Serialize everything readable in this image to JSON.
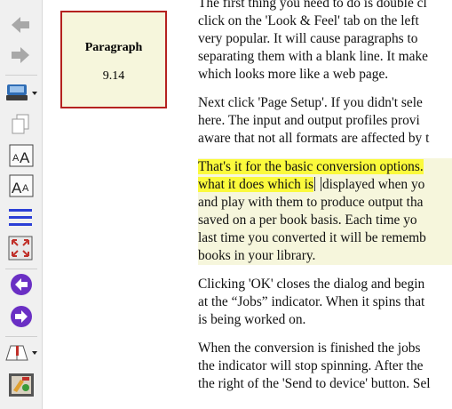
{
  "reference_panel": {
    "title": "Paragraph",
    "value": "9.14"
  },
  "paragraphs": [
    [
      "The first thing you need to do is double cl",
      "click on the 'Look & Feel' tab on the left",
      "very popular. It will cause paragraphs to",
      "separating them with a blank line. It make",
      "which looks more like a web page."
    ],
    [
      "Next click 'Page Setup'. If you didn't sele",
      "here. The input and output profiles provi",
      "aware that not all formats are affected by t"
    ],
    [
      "Clicking 'OK' closes the dialog and begin",
      "at the “Jobs” indicator. When it spins that",
      "is being worked on."
    ],
    [
      "When the conversion is finished the jobs",
      "the indicator will stop spinning. After the",
      "the right of the 'Send to device' button. Sel"
    ]
  ],
  "highlight_paragraph": {
    "line1": "That's it for the basic conversion options.",
    "line2_a": "what it does which is",
    "line2_b": "displayed when yo",
    "rest": [
      "and play with them to produce output tha",
      "saved on a per book basis. Each time yo",
      "last time you converted it will be rememb",
      "books in your library."
    ]
  },
  "colors": {
    "highlight_yellow": "#fbfa3c",
    "highlight_cream": "#f6f6dc",
    "panel_border": "#b5221f",
    "toolbar_bg": "#f0f0f0"
  },
  "toolbar_icons": [
    "back-arrow-icon",
    "forward-arrow-icon",
    "print-icon",
    "copy-icon",
    "font-larger-icon",
    "font-smaller-icon",
    "table-of-contents-icon",
    "fullscreen-icon",
    "previous-page-icon",
    "next-page-icon",
    "bookmark-icon",
    "preferences-icon"
  ]
}
